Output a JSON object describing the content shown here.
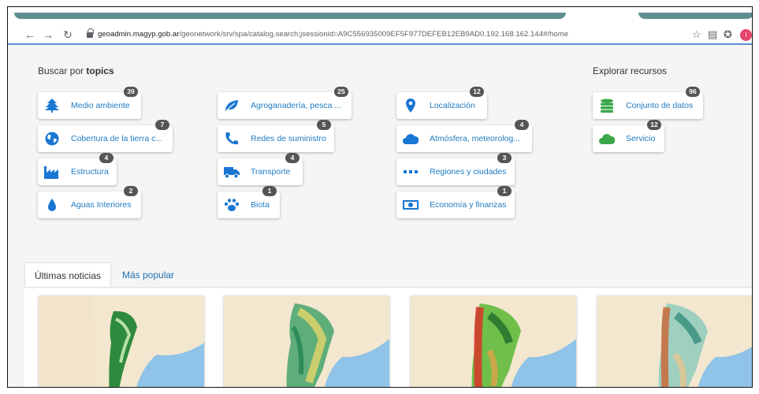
{
  "browser": {
    "url_host": "geoadmin.magyp.gob.ar",
    "url_path": "/geonetwork/srv/spa/catalog.search;jsessionid=A9C556935009EF5F977DEFEB12EB9AD0.192.168.162.144#/home",
    "profile_initial": "I"
  },
  "topics": {
    "heading_prefix": "Buscar por",
    "heading_bold": "topics",
    "items": [
      {
        "label": "Medio ambiente",
        "count": "39",
        "icon": "tree-icon"
      },
      {
        "label": "Cobertura de la tierra c...",
        "count": "7",
        "icon": "globe-icon"
      },
      {
        "label": "Estructura",
        "count": "4",
        "icon": "factory-icon"
      },
      {
        "label": "Aguas Interiores",
        "count": "2",
        "icon": "water-drop-icon"
      },
      {
        "label": "Agroganadería, pesca ...",
        "count": "25",
        "icon": "leaf-icon"
      },
      {
        "label": "Redes de suministro",
        "count": "5",
        "icon": "phone-icon"
      },
      {
        "label": "Transporte",
        "count": "4",
        "icon": "truck-icon"
      },
      {
        "label": "Biota",
        "count": "1",
        "icon": "paw-icon"
      },
      {
        "label": "Localización",
        "count": "12",
        "icon": "map-marker-icon"
      },
      {
        "label": "Atmósfera, meteorolog...",
        "count": "4",
        "icon": "cloud-icon"
      },
      {
        "label": "Regiones y ciudades",
        "count": "3",
        "icon": "ellipsis-icon"
      },
      {
        "label": "Economía y finanzas",
        "count": "1",
        "icon": "money-icon"
      }
    ]
  },
  "resources": {
    "heading": "Explorar recursos",
    "items": [
      {
        "label": "Conjunto de datos",
        "count": "96",
        "icon": "database-icon"
      },
      {
        "label": "Servicio",
        "count": "12",
        "icon": "cloud-icon"
      }
    ]
  },
  "news_tabs": [
    {
      "label": "Últimas noticias",
      "active": true
    },
    {
      "label": "Más popular",
      "active": false
    }
  ],
  "colors": {
    "link": "#1f7bc1",
    "icon_blue": "#1976d2",
    "icon_green": "#3aa64a",
    "badge": "#555555"
  }
}
